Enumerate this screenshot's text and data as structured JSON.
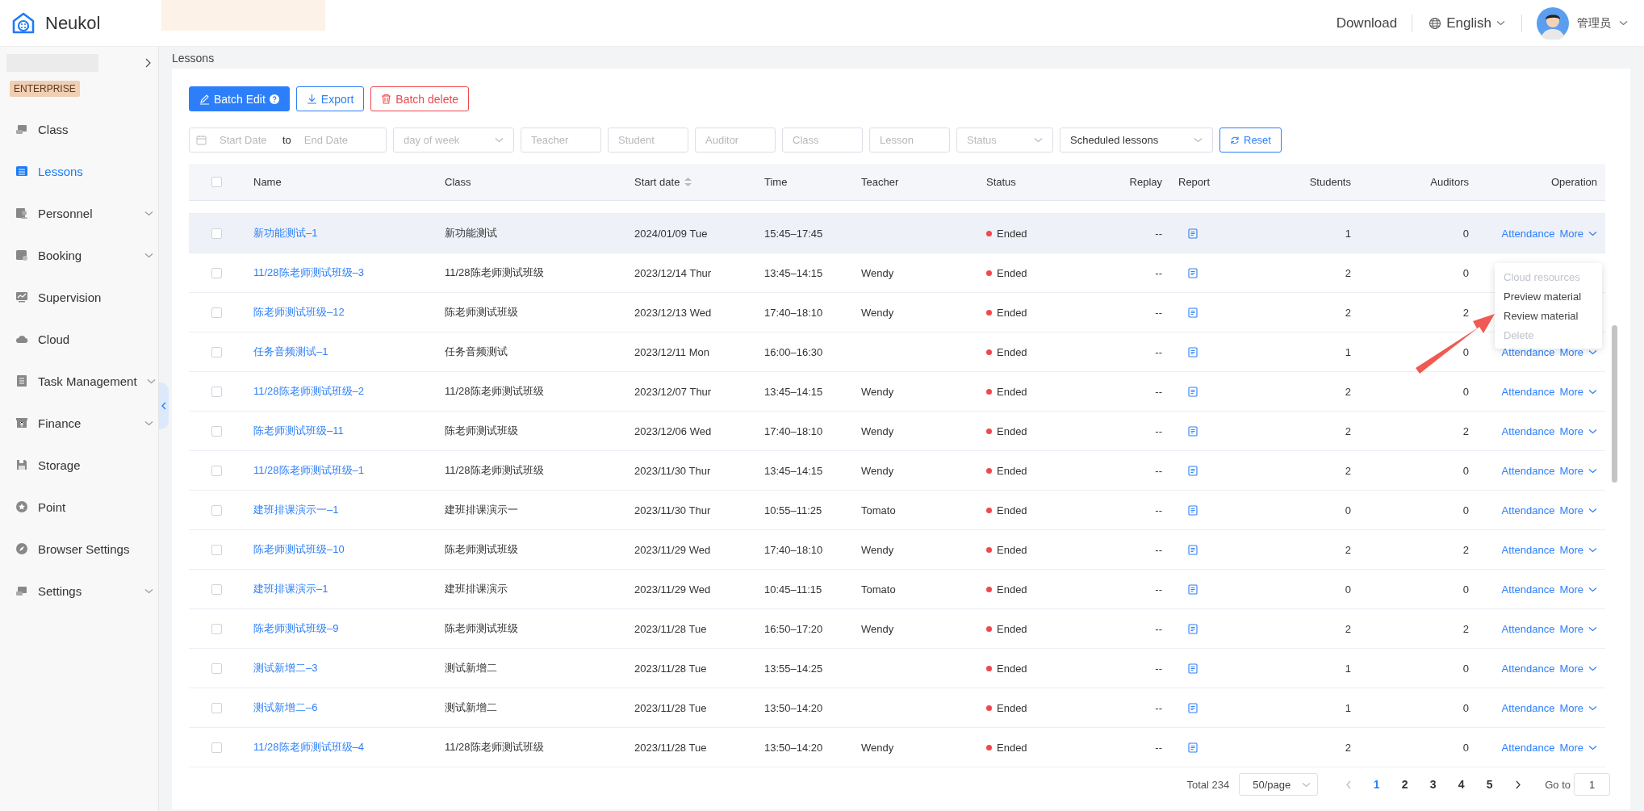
{
  "header": {
    "logo_text": "Neukol",
    "download": "Download",
    "language": "English",
    "user": "管理员"
  },
  "sidebar": {
    "badge": "ENTERPRISE",
    "items": [
      {
        "label": "Class",
        "selected": false,
        "expandable": false
      },
      {
        "label": "Lessons",
        "selected": true,
        "expandable": false
      },
      {
        "label": "Personnel",
        "selected": false,
        "expandable": true
      },
      {
        "label": "Booking",
        "selected": false,
        "expandable": true
      },
      {
        "label": "Supervision",
        "selected": false,
        "expandable": false
      },
      {
        "label": "Cloud",
        "selected": false,
        "expandable": false
      },
      {
        "label": "Task Management",
        "selected": false,
        "expandable": true
      },
      {
        "label": "Finance",
        "selected": false,
        "expandable": true
      },
      {
        "label": "Storage",
        "selected": false,
        "expandable": false
      },
      {
        "label": "Point",
        "selected": false,
        "expandable": false
      },
      {
        "label": "Browser Settings",
        "selected": false,
        "expandable": false
      },
      {
        "label": "Settings",
        "selected": false,
        "expandable": true
      }
    ]
  },
  "breadcrumb": "Lessons",
  "toolbar": {
    "buttons": [
      {
        "label": "Batch Edit",
        "kind": "primary"
      },
      {
        "label": "Export",
        "kind": "outline"
      },
      {
        "label": "Batch delete",
        "kind": "danger"
      }
    ]
  },
  "filters": [
    {
      "kind": "daterange",
      "start_placeholder": "Start Date",
      "separator": "to",
      "end_placeholder": "End Date"
    },
    {
      "kind": "select",
      "placeholder": "day of week"
    },
    {
      "kind": "input",
      "placeholder": "Teacher"
    },
    {
      "kind": "input",
      "placeholder": "Student"
    },
    {
      "kind": "input",
      "placeholder": "Auditor"
    },
    {
      "kind": "input",
      "placeholder": "Class"
    },
    {
      "kind": "input",
      "placeholder": "Lesson"
    },
    {
      "kind": "select",
      "placeholder": "Status"
    },
    {
      "kind": "select",
      "value": "Scheduled lessons"
    },
    {
      "kind": "button",
      "label": "Reset"
    }
  ],
  "table": {
    "header_checked": false,
    "columns": [
      {
        "label": "Name",
        "sortable": false
      },
      {
        "label": "Class",
        "sortable": false
      },
      {
        "label": "Start date",
        "sortable": true
      },
      {
        "label": "Time",
        "sortable": false
      },
      {
        "label": "Teacher",
        "sortable": false
      },
      {
        "label": "Status",
        "sortable": false
      },
      {
        "label": "Replay",
        "sortable": false
      },
      {
        "label": "Report",
        "sortable": false
      },
      {
        "label": "Students",
        "sortable": false
      },
      {
        "label": "Auditors",
        "sortable": false
      },
      {
        "label": "Operation",
        "sortable": false
      }
    ],
    "rows": [
      {
        "checked": false,
        "hovered": true,
        "name": "新功能测试–1",
        "class": "新功能测试",
        "start_date": "2024/01/09 Tue",
        "time": "15:45–17:45",
        "status": "Ended",
        "replay": "--",
        "students": "1",
        "auditors": "0",
        "operations": {
          "attendance": "Attendance",
          "more": "More"
        }
      },
      {
        "checked": false,
        "hovered": false,
        "name": "11/28陈老师测试班级–3",
        "class": "11/28陈老师测试班级",
        "start_date": "2023/12/14 Thur",
        "time": "13:45–14:15",
        "teacher": "Wendy",
        "status": "Ended",
        "replay": "--",
        "students": "2",
        "auditors": "0"
      },
      {
        "checked": false,
        "hovered": false,
        "name": "陈老师测试班级–12",
        "class": "陈老师测试班级",
        "start_date": "2023/12/13 Wed",
        "time": "17:40–18:10",
        "teacher": "Wendy",
        "status": "Ended",
        "replay": "--",
        "students": "2",
        "auditors": "2"
      },
      {
        "checked": false,
        "hovered": false,
        "name": "任务音频测试–1",
        "class": "任务音频测试",
        "start_date": "2023/12/11 Mon",
        "time": "16:00–16:30",
        "status": "Ended",
        "replay": "--",
        "students": "1",
        "auditors": "0",
        "operations": {
          "attendance": "Attendance",
          "more": "More"
        }
      },
      {
        "checked": false,
        "hovered": false,
        "name": "11/28陈老师测试班级–2",
        "class": "11/28陈老师测试班级",
        "start_date": "2023/12/07 Thur",
        "time": "13:45–14:15",
        "teacher": "Wendy",
        "status": "Ended",
        "replay": "--",
        "students": "2",
        "auditors": "0",
        "operations": {
          "attendance": "Attendance",
          "more": "More"
        }
      },
      {
        "checked": false,
        "hovered": false,
        "name": "陈老师测试班级–11",
        "class": "陈老师测试班级",
        "start_date": "2023/12/06 Wed",
        "time": "17:40–18:10",
        "teacher": "Wendy",
        "status": "Ended",
        "replay": "--",
        "students": "2",
        "auditors": "2",
        "operations": {
          "attendance": "Attendance",
          "more": "More"
        }
      },
      {
        "checked": false,
        "hovered": false,
        "name": "11/28陈老师测试班级–1",
        "class": "11/28陈老师测试班级",
        "start_date": "2023/11/30 Thur",
        "time": "13:45–14:15",
        "teacher": "Wendy",
        "status": "Ended",
        "replay": "--",
        "students": "2",
        "auditors": "0",
        "operations": {
          "attendance": "Attendance",
          "more": "More"
        }
      },
      {
        "checked": false,
        "hovered": false,
        "name": "建班排课演示一–1",
        "class": "建班排课演示一",
        "start_date": "2023/11/30 Thur",
        "time": "10:55–11:25",
        "teacher": "Tomato",
        "status": "Ended",
        "replay": "--",
        "students": "0",
        "auditors": "0",
        "operations": {
          "attendance": "Attendance",
          "more": "More"
        }
      },
      {
        "checked": false,
        "hovered": false,
        "name": "陈老师测试班级–10",
        "class": "陈老师测试班级",
        "start_date": "2023/11/29 Wed",
        "time": "17:40–18:10",
        "teacher": "Wendy",
        "status": "Ended",
        "replay": "--",
        "students": "2",
        "auditors": "2",
        "operations": {
          "attendance": "Attendance",
          "more": "More"
        }
      },
      {
        "checked": false,
        "hovered": false,
        "name": "建班排课演示–1",
        "class": "建班排课演示",
        "start_date": "2023/11/29 Wed",
        "time": "10:45–11:15",
        "teacher": "Tomato",
        "status": "Ended",
        "replay": "--",
        "students": "0",
        "auditors": "0",
        "operations": {
          "attendance": "Attendance",
          "more": "More"
        }
      },
      {
        "checked": false,
        "hovered": false,
        "name": "陈老师测试班级–9",
        "class": "陈老师测试班级",
        "start_date": "2023/11/28 Tue",
        "time": "16:50–17:20",
        "teacher": "Wendy",
        "status": "Ended",
        "replay": "--",
        "students": "2",
        "auditors": "2",
        "operations": {
          "attendance": "Attendance",
          "more": "More"
        }
      },
      {
        "checked": false,
        "hovered": false,
        "name": "测试新增二–3",
        "class": "测试新增二",
        "start_date": "2023/11/28 Tue",
        "time": "13:55–14:25",
        "status": "Ended",
        "replay": "--",
        "students": "1",
        "auditors": "0",
        "operations": {
          "attendance": "Attendance",
          "more": "More"
        }
      },
      {
        "checked": false,
        "hovered": false,
        "name": "测试新增二–6",
        "class": "测试新增二",
        "start_date": "2023/11/28 Tue",
        "time": "13:50–14:20",
        "status": "Ended",
        "replay": "--",
        "students": "1",
        "auditors": "0",
        "operations": {
          "attendance": "Attendance",
          "more": "More"
        }
      },
      {
        "checked": false,
        "hovered": false,
        "name": "11/28陈老师测试班级–4",
        "class": "11/28陈老师测试班级",
        "start_date": "2023/11/28 Tue",
        "time": "13:50–14:20",
        "teacher": "Wendy",
        "status": "Ended",
        "replay": "--",
        "students": "2",
        "auditors": "0",
        "operations": {
          "attendance": "Attendance",
          "more": "More"
        }
      }
    ]
  },
  "more_menu": {
    "items": [
      {
        "label": "Cloud resources",
        "disabled": true
      },
      {
        "label": "Preview material",
        "disabled": false
      },
      {
        "label": "Review material",
        "disabled": false
      },
      {
        "label": "Delete",
        "disabled": true
      }
    ]
  },
  "pagination": {
    "total": "Total 234",
    "page_size": "50/page",
    "pages": [
      {
        "label": "1",
        "selected": true
      },
      {
        "label": "2",
        "selected": false
      },
      {
        "label": "3",
        "selected": false
      },
      {
        "label": "4",
        "selected": false
      },
      {
        "label": "5",
        "selected": false
      }
    ],
    "goto_label": "Go to",
    "goto_value": "1"
  }
}
